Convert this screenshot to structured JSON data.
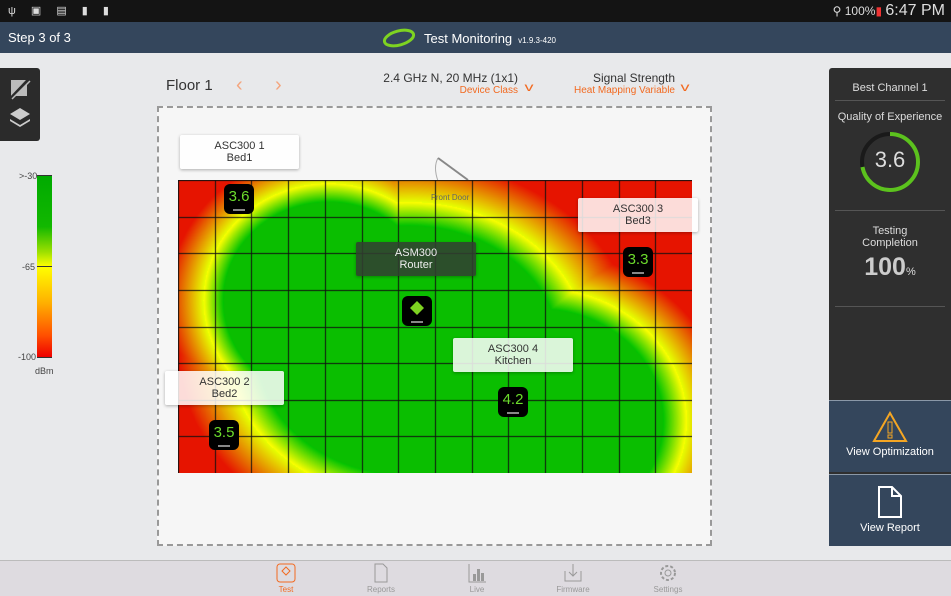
{
  "status_bar": {
    "icons": [
      "usb-icon",
      "image-icon",
      "mail-icon",
      "alert-icon",
      "alert-icon"
    ],
    "wifi": "wifi-icon",
    "battery": "100%",
    "time": "6:47 PM"
  },
  "header": {
    "step": "Step 3 of 3",
    "title": "Test Monitoring",
    "version": "v1.9.3-420"
  },
  "legend": {
    "top": ">-30",
    "mid": "-65",
    "bottom": "-100",
    "unit": "dBm"
  },
  "floor": {
    "label": "Floor 1"
  },
  "device_class": {
    "value": "2.4 GHz N, 20 MHz (1x1)",
    "label": "Device Class"
  },
  "heat_variable": {
    "value": "Signal Strength",
    "label": "Heat Mapping Variable"
  },
  "map": {
    "door_label": "Front Door",
    "grid": {
      "cols": 14,
      "rows": 8
    }
  },
  "devices": [
    {
      "name": "ASC300 1",
      "room": "Bed1",
      "score": "3.6"
    },
    {
      "name": "ASC300 3",
      "room": "Bed3",
      "score": "3.3"
    },
    {
      "name": "ASM300",
      "room": "Router",
      "score": ""
    },
    {
      "name": "ASC300 4",
      "room": "Kitchen",
      "score": "4.2"
    },
    {
      "name": "ASC300 2",
      "room": "Bed2",
      "score": "3.5"
    }
  ],
  "side": {
    "best_channel": "Best Channel 1",
    "qoe_label": "Quality of Experience",
    "qoe_value": "3.6",
    "qoe_max": 5,
    "completion_label_1": "Testing",
    "completion_label_2": "Completion",
    "completion_value": "100",
    "completion_unit": "%",
    "optimization": "View Optimization",
    "report": "View Report",
    "accent": "#5cc21e"
  },
  "tabs": [
    {
      "label": "Test",
      "icon": "test-icon"
    },
    {
      "label": "Reports",
      "icon": "document-icon"
    },
    {
      "label": "Live",
      "icon": "bar-chart-icon"
    },
    {
      "label": "Firmware",
      "icon": "download-icon"
    },
    {
      "label": "Settings",
      "icon": "gear-icon"
    }
  ]
}
